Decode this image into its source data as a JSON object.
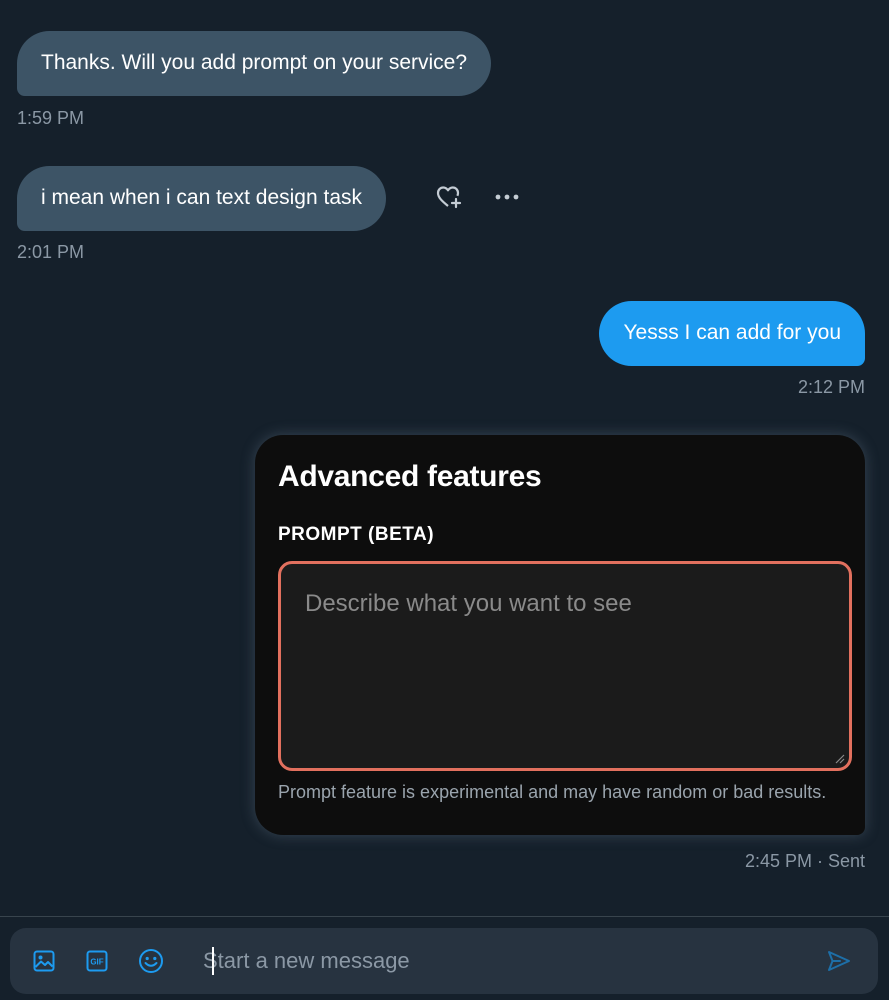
{
  "messages": [
    {
      "text": "Thanks.  Will you add prompt on your service?",
      "time": "1:59 PM"
    },
    {
      "text": "i mean when i can text design task",
      "time": "2:01 PM"
    },
    {
      "text": "Yesss I can add for you",
      "time": "2:12 PM"
    }
  ],
  "card": {
    "title": "Advanced features",
    "label": "PROMPT (BETA)",
    "placeholder": "Describe what you want to see",
    "note": "Prompt feature is experimental and may have random or bad results.",
    "time": "2:45 PM · Sent"
  },
  "composer": {
    "placeholder": "Start a new message"
  },
  "colors": {
    "background": "#15202b",
    "incoming_bubble": "#3d5466",
    "outgoing_bubble": "#1d9bf0",
    "accent": "#1d9bf0",
    "prompt_border": "#e2705e"
  },
  "icons": [
    "heart-plus-icon",
    "more-icon",
    "image-icon",
    "gif-icon",
    "emoji-icon",
    "send-icon"
  ]
}
